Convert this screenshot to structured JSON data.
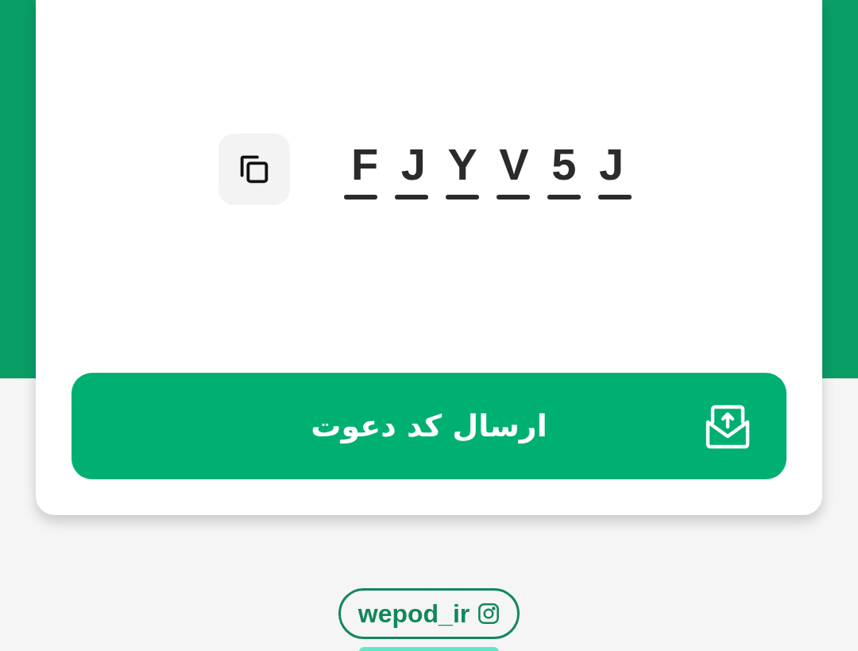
{
  "invite_code": {
    "code": "F J Y V 5 J"
  },
  "send_button": {
    "label": "ارسال کد دعوت"
  },
  "social_link": {
    "handle": "wepod_ir"
  }
}
